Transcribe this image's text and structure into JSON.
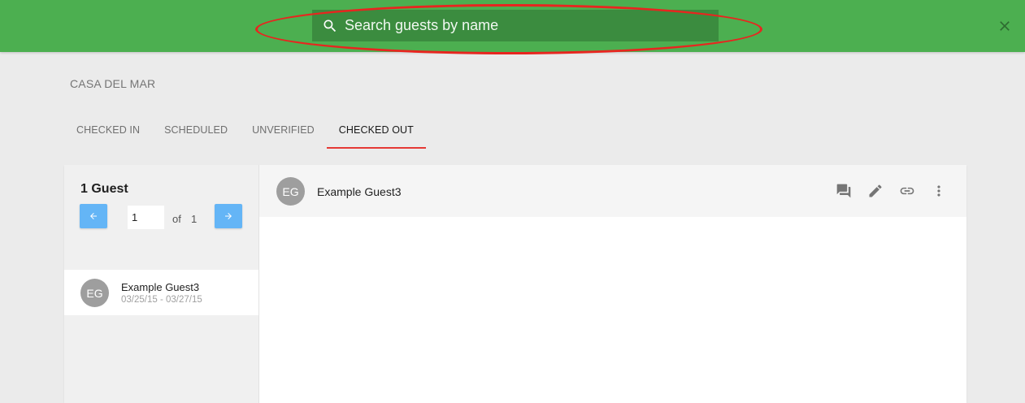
{
  "search": {
    "placeholder": "Search guests by name",
    "value": "",
    "icon": "search-icon"
  },
  "header": {
    "close_icon": "close-icon",
    "bar_color": "#4caf50",
    "highlight_color": "#e8251f"
  },
  "property": {
    "name": "CASA DEL MAR"
  },
  "tabs": [
    {
      "label": "CHECKED IN",
      "active": false
    },
    {
      "label": "SCHEDULED",
      "active": false
    },
    {
      "label": "UNVERIFIED",
      "active": false
    },
    {
      "label": "CHECKED OUT",
      "active": true
    }
  ],
  "list": {
    "count_label": "1 Guest",
    "pagination": {
      "current": "1",
      "of_label": "of",
      "total": "1",
      "prev_icon": "arrow-left-icon",
      "next_icon": "arrow-right-icon"
    },
    "guests": [
      {
        "initials": "EG",
        "name": "Example Guest3",
        "dates": "03/25/15 - 03/27/15"
      }
    ]
  },
  "detail": {
    "initials": "EG",
    "name": "Example Guest3",
    "actions": [
      "message-icon",
      "edit-icon",
      "link-icon",
      "more-vert-icon"
    ]
  }
}
